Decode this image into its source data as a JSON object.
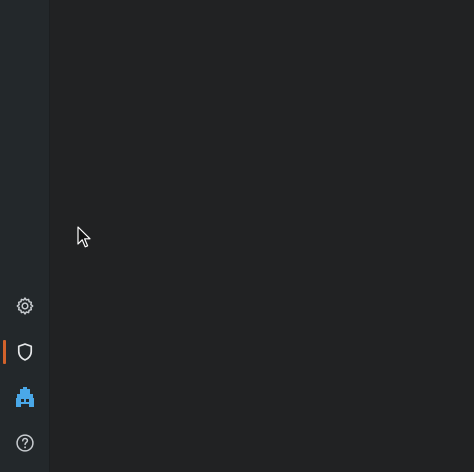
{
  "sidebar": {
    "items": [
      {
        "id": "settings",
        "icon": "gear-icon",
        "active": false
      },
      {
        "id": "security",
        "icon": "shield-icon",
        "active": true
      },
      {
        "id": "agent",
        "icon": "robot-icon",
        "active": false
      },
      {
        "id": "help",
        "icon": "help-icon",
        "active": false
      }
    ]
  },
  "colors": {
    "sidebar_bg": "#23282b",
    "main_bg": "#212223",
    "icon_default": "#c8ccd0",
    "active_marker": "#d2622b",
    "agent_icon": "#4aa8e8"
  }
}
